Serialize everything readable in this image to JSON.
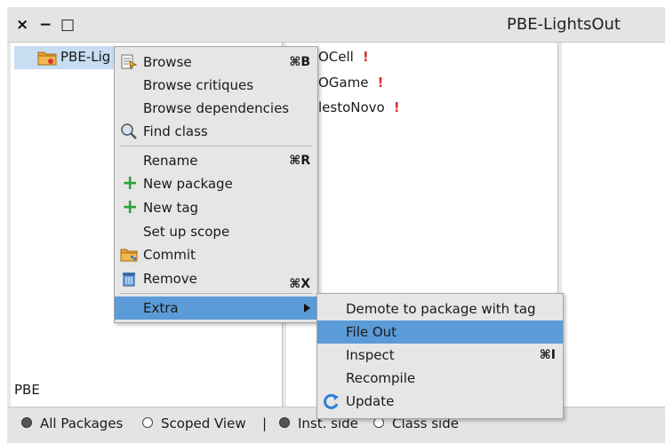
{
  "window": {
    "title": "PBE-LightsOut",
    "close_glyph": "×",
    "minimize_glyph": "−",
    "maximize_glyph": "□"
  },
  "package_pane": {
    "selected_item": "PBE-Lig",
    "scope_label": "PBE"
  },
  "class_pane": {
    "items": [
      {
        "label": "OCell",
        "warning": "!"
      },
      {
        "label": "OGame",
        "warning": "!"
      },
      {
        "label": "lestoNovo",
        "warning": "!"
      }
    ]
  },
  "context_menu": {
    "items": [
      {
        "label": "Browse",
        "shortcut": "⌘B",
        "icon": "browse-icon"
      },
      {
        "label": "Browse critiques"
      },
      {
        "label": "Browse dependencies"
      },
      {
        "label": "Find class",
        "icon": "magnifier-icon"
      },
      {
        "label": "Rename",
        "shortcut": "⌘R"
      },
      {
        "label": "New package",
        "icon": "plus-icon"
      },
      {
        "label": "New tag",
        "icon": "plus-icon"
      },
      {
        "label": "Set up scope"
      },
      {
        "label": "Commit",
        "icon": "package-icon"
      },
      {
        "label": "Remove",
        "shortcut": "⌘X",
        "icon": "trash-icon"
      },
      {
        "label": "Extra",
        "has_submenu": true,
        "highlighted": true
      }
    ]
  },
  "submenu": {
    "items": [
      {
        "label": "Demote to package with tag"
      },
      {
        "label": "File Out",
        "highlighted": true
      },
      {
        "label": "Inspect",
        "shortcut": "⌘I"
      },
      {
        "label": "Recompile"
      },
      {
        "label": "Update",
        "icon": "refresh-icon"
      }
    ]
  },
  "status_bar": {
    "all_packages": "All Packages",
    "scoped_view": "Scoped View",
    "separator": "|",
    "inst_side": "Inst. side",
    "class_side": "Class side",
    "all_packages_selected": true,
    "inst_side_selected": true
  },
  "colors": {
    "highlight": "#5a9bd8",
    "selection": "#c6ddf2",
    "warning": "#dd3333"
  }
}
